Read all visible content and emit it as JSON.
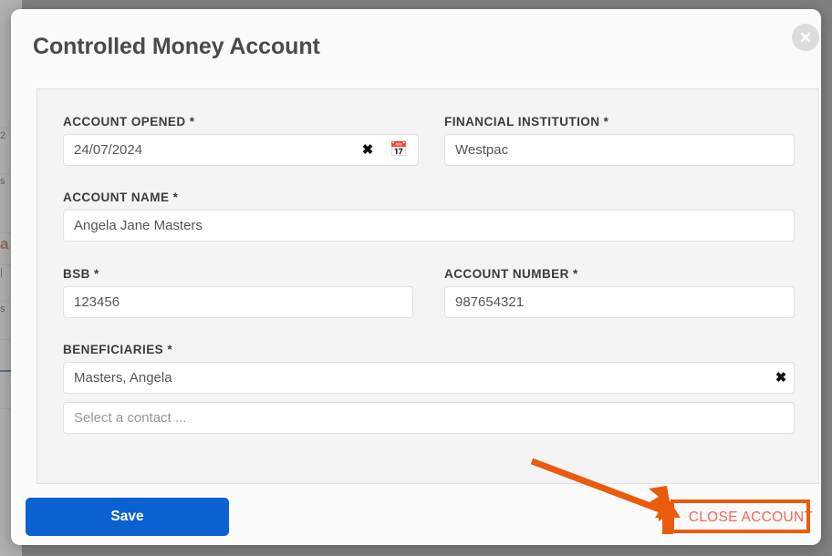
{
  "modal": {
    "title": "Controlled Money Account",
    "close_icon": "close-x-icon"
  },
  "form": {
    "fields": [
      {
        "key": "account_opened",
        "label": "ACCOUNT OPENED *",
        "value": "24/07/2024",
        "placeholder": "",
        "clear_icon": "clear-x-icon",
        "calendar_icon": "📅"
      },
      {
        "key": "financial_institution",
        "label": "FINANCIAL INSTITUTION *",
        "value": "Westpac",
        "placeholder": ""
      },
      {
        "key": "account_name",
        "label": "ACCOUNT NAME *",
        "value": "Angela Jane Masters",
        "placeholder": ""
      },
      {
        "key": "bsb",
        "label": "BSB *",
        "value": "123456",
        "placeholder": ""
      },
      {
        "key": "account_number",
        "label": "ACCOUNT NUMBER *",
        "value": "987654321",
        "placeholder": ""
      },
      {
        "key": "beneficiaries",
        "label": "BENEFICIARIES *",
        "value": "Masters, Angela",
        "clear_icon": "clear-x-icon",
        "placeholder": "Select a contact ..."
      }
    ]
  },
  "footer": {
    "save_label": "Save",
    "close_account_label": "CLOSE ACCOUNT"
  },
  "annotation": {
    "arrow_color": "#ea5b0c",
    "box_color": "#ea5b0c",
    "target": "close-account-button"
  },
  "colors": {
    "primary_button": "#0a62d0",
    "danger_text": "#fa6450",
    "annotation": "#ea5b0c",
    "panel_bg": "#f4f4f4",
    "modal_bg": "#fbfbfb",
    "backdrop": "#808080"
  },
  "background_page": {
    "rows": [
      "2",
      "s",
      "a",
      "|",
      "s",
      "",
      "",
      ""
    ]
  }
}
